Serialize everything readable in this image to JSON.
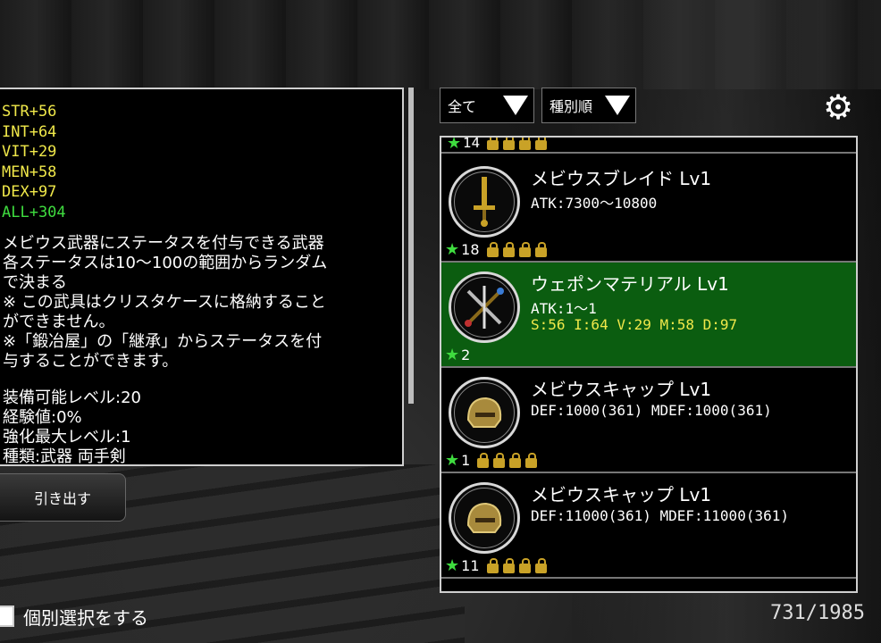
{
  "detail": {
    "stats": [
      {
        "text": "STR+56",
        "color": "#f0e84a"
      },
      {
        "text": "INT+64",
        "color": "#f0e84a"
      },
      {
        "text": "VIT+29",
        "color": "#f0e84a"
      },
      {
        "text": "MEN+58",
        "color": "#f0e84a"
      },
      {
        "text": "DEX+97",
        "color": "#f0e84a"
      },
      {
        "text": "ALL+304",
        "color": "#3fdc3f"
      }
    ],
    "description": [
      "メビウス武器にステータスを付与できる武器",
      "各ステータスは10～100の範囲からランダム",
      "で決まる",
      "※ この武具はクリスタケースに格納すること",
      "ができません。",
      "※「鍛冶屋」の「継承」からステータスを付",
      "与することができます。"
    ],
    "info": [
      "装備可能レベル:20",
      "経験値:0%",
      "強化最大レベル:1",
      "種類:武器 両手剣"
    ]
  },
  "extract_button": "引き出す",
  "individual_select": "個別選択をする",
  "filters": {
    "category": "全て",
    "sort": "種別順"
  },
  "list": {
    "partial_top_count": "14",
    "items": [
      {
        "name": "メビウスブレイド Lv1",
        "line1": "ATK:7300～10800",
        "line2": "",
        "count": "18",
        "locks": 4,
        "selected": false,
        "icon": "sword-icon"
      },
      {
        "name": "ウェポンマテリアル Lv1",
        "line1": "ATK:1～1",
        "line2": "S:56 I:64 V:29 M:58 D:97",
        "count": "2",
        "locks": 0,
        "selected": true,
        "icon": "weapons-material-icon"
      },
      {
        "name": "メビウスキャップ Lv1",
        "line1": "DEF:1000(361) MDEF:1000(361)",
        "line2": "",
        "count": "1",
        "locks": 4,
        "selected": false,
        "icon": "helmet-icon"
      },
      {
        "name": "メビウスキャップ Lv1",
        "line1": "DEF:11000(361) MDEF:11000(361)",
        "line2": "",
        "count": "11",
        "locks": 4,
        "selected": false,
        "icon": "helmet-icon"
      }
    ]
  },
  "counter": "731/1985"
}
